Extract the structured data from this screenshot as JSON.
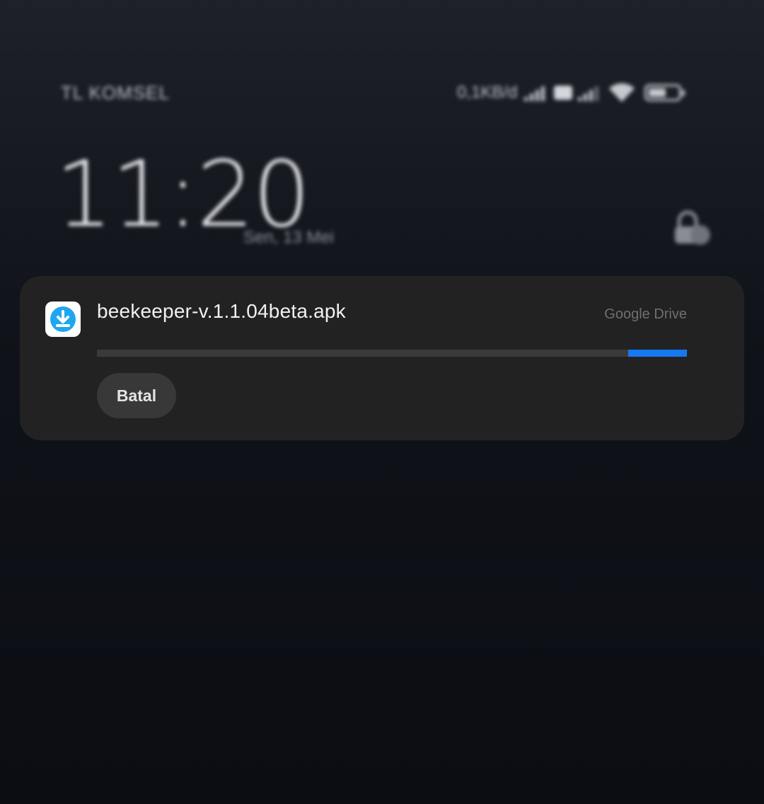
{
  "status_bar": {
    "carrier": "TL KOMSEL",
    "net_speed": "0,1KB/d",
    "icons": [
      "signal-icon",
      "hd-badge-icon",
      "signal-icon",
      "wifi-icon",
      "battery-icon"
    ]
  },
  "lockscreen": {
    "time": "11:20",
    "date": "Sen, 13 Mei",
    "icon": "lock-icon"
  },
  "notification": {
    "app_icon": "download-icon",
    "filename": "beekeeper-v.1.1.04beta.apk",
    "source": "Google Drive",
    "progress": 0.1,
    "cancel_label": "Batal",
    "accent_color": "#1679f2"
  }
}
